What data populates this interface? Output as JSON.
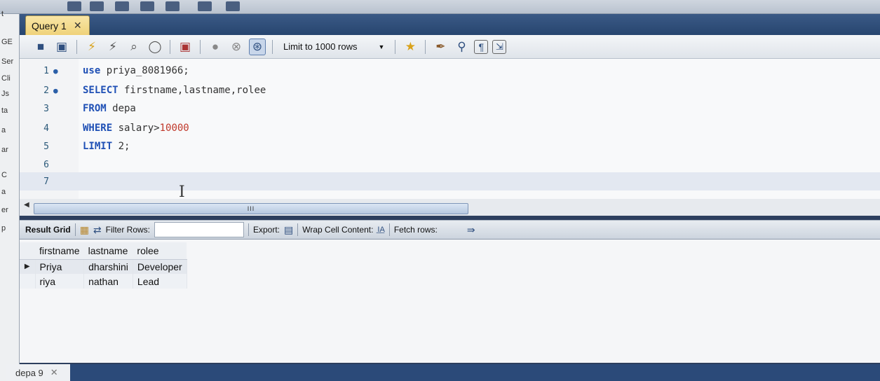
{
  "editor": {
    "tab_label": "Query 1",
    "limit_label": "Limit to 1000 rows",
    "lines": [
      {
        "n": "1",
        "text": "use priya_8081966;"
      },
      {
        "n": "2",
        "text": "SELECT firstname,lastname,rolee"
      },
      {
        "n": "3",
        "text": "FROM depa"
      },
      {
        "n": "4",
        "text": "WHERE salary>10000"
      },
      {
        "n": "5",
        "text": "LIMIT 2;"
      },
      {
        "n": "6",
        "text": ""
      },
      {
        "n": "7",
        "text": ""
      }
    ]
  },
  "left_panel_fragments": [
    "t",
    "GE",
    "Ser",
    "Cli",
    "Js",
    "ta",
    "a",
    "ar",
    "C",
    "a",
    "er",
    "p"
  ],
  "scrollbar": {
    "grip": "III"
  },
  "result": {
    "result_grid_label": "Result Grid",
    "filter_rows_label": "Filter Rows:",
    "export_label": "Export:",
    "wrap_label": "Wrap Cell Content:",
    "fetch_label": "Fetch rows:",
    "columns": [
      "firstname",
      "lastname",
      "rolee"
    ],
    "rows": [
      [
        "Priya",
        "dharshini",
        "Developer"
      ],
      [
        "riya",
        "nathan",
        "Lead"
      ]
    ]
  },
  "output_tab": {
    "label": "depa 9"
  },
  "colors": {
    "tab_active": "#efd27a",
    "keyword": "#1f50b5",
    "number": "#c0392b",
    "chrome": "#2b4a79"
  }
}
